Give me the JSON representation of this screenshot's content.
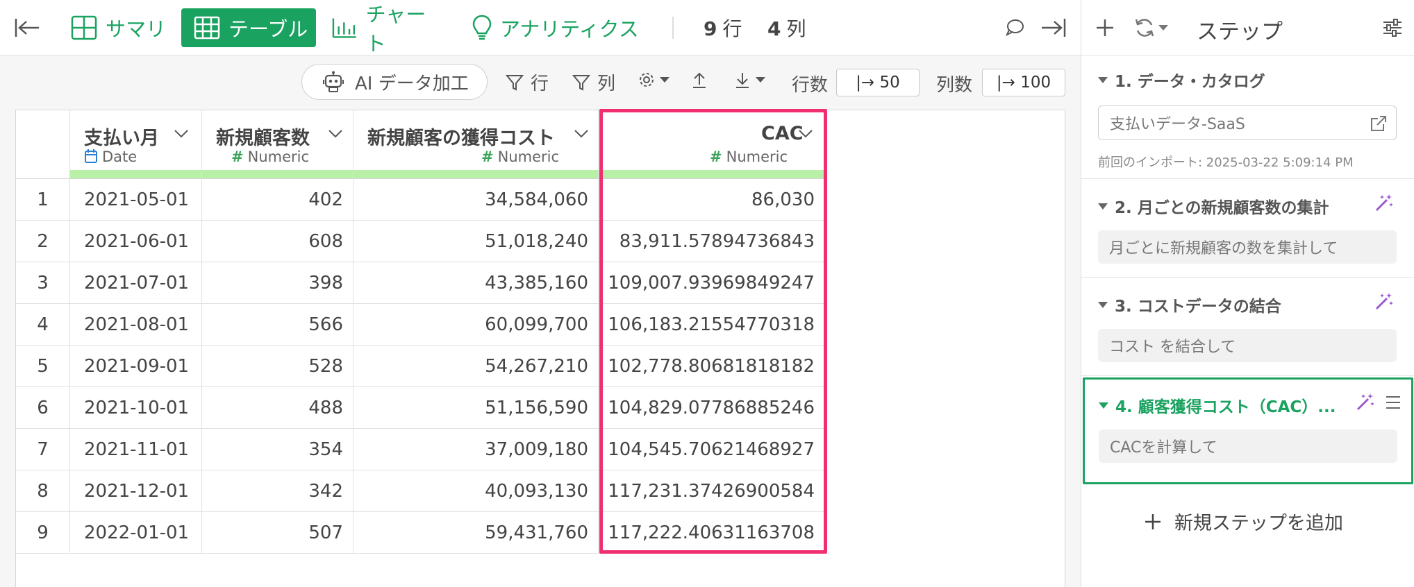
{
  "topbar": {
    "collapse_icon": "collapse-left-icon",
    "tabs": [
      {
        "label": "サマリ",
        "icon": "summary-icon"
      },
      {
        "label": "テーブル",
        "icon": "table-icon",
        "active": true
      },
      {
        "label": "チャート",
        "icon": "chart-icon"
      },
      {
        "label": "アナリティクス",
        "icon": "bulb-icon"
      }
    ],
    "row_count": "9",
    "row_unit": "行",
    "col_count": "4",
    "col_unit": "列",
    "comment_icon": "comment-icon",
    "expand_icon": "expand-right-icon"
  },
  "toolbar": {
    "ai_label": "AI データ加工",
    "filter_row": "行",
    "filter_col": "列",
    "rows_label": "行数",
    "rows_value": "|→ 50",
    "cols_label": "列数",
    "cols_value": "|→ 100"
  },
  "table": {
    "columns": [
      {
        "name": "支払い月",
        "type": "Date"
      },
      {
        "name": "新規顧客数",
        "type": "Numeric"
      },
      {
        "name": "新規顧客の獲得コスト",
        "type": "Numeric"
      },
      {
        "name": "CAC",
        "type": "Numeric"
      }
    ],
    "rows": [
      [
        "1",
        "2021-05-01",
        "402",
        "34,584,060",
        "86,030"
      ],
      [
        "2",
        "2021-06-01",
        "608",
        "51,018,240",
        "83,911.57894736843"
      ],
      [
        "3",
        "2021-07-01",
        "398",
        "43,385,160",
        "109,007.93969849247"
      ],
      [
        "4",
        "2021-08-01",
        "566",
        "60,099,700",
        "106,183.21554770318"
      ],
      [
        "5",
        "2021-09-01",
        "528",
        "54,267,210",
        "102,778.80681818182"
      ],
      [
        "6",
        "2021-10-01",
        "488",
        "51,156,590",
        "104,829.07786885246"
      ],
      [
        "7",
        "2021-11-01",
        "354",
        "37,009,180",
        "104,545.70621468927"
      ],
      [
        "8",
        "2021-12-01",
        "342",
        "40,093,130",
        "117,231.37426900584"
      ],
      [
        "9",
        "2022-01-01",
        "507",
        "59,431,760",
        "117,222.40631163708"
      ]
    ]
  },
  "steps_panel": {
    "title": "ステップ",
    "steps": [
      {
        "title": "1. データ・カタログ",
        "box": "支払いデータ-SaaS",
        "note": "前回のインポート: 2025-03-22 5:09:14 PM"
      },
      {
        "title": "2. 月ごとの新規顧客数の集計",
        "box": "月ごとに新規顧客の数を集計して"
      },
      {
        "title": "3. コストデータの結合",
        "box": "コスト を結合して"
      },
      {
        "title": "4. 顧客獲得コスト（CAC）...",
        "box": "CACを計算して",
        "active": true
      }
    ],
    "add_label": "新規ステップを追加"
  },
  "colors": {
    "accent": "#1aa260",
    "highlight": "#f0306e",
    "wand": "#9b59d0"
  }
}
